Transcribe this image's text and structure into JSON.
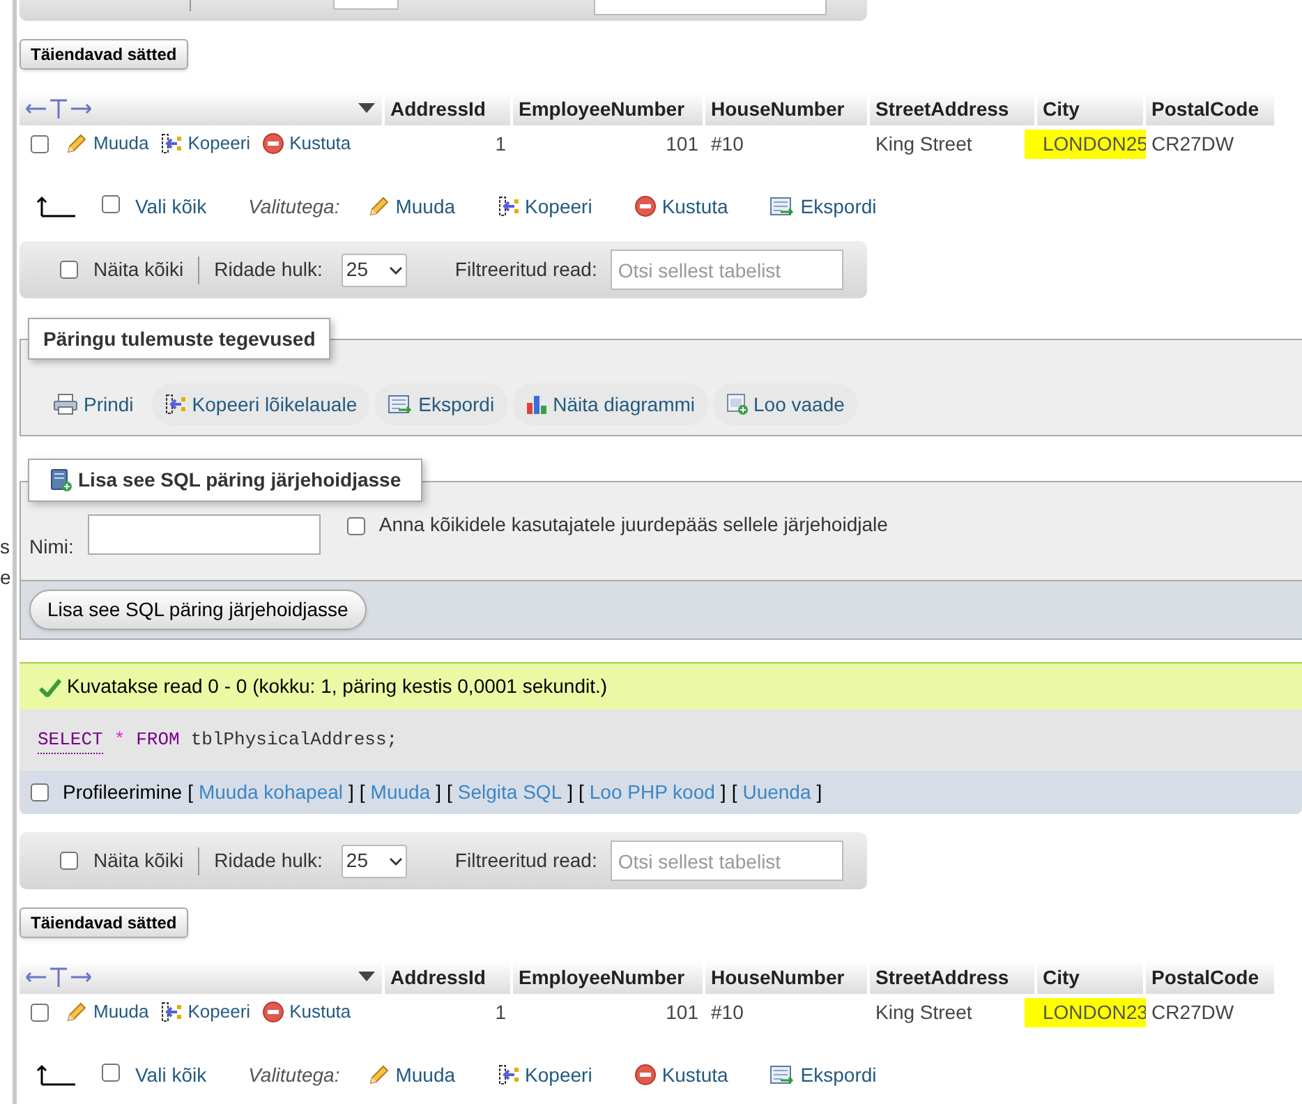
{
  "left_edge_fragments": [
    "s",
    "e"
  ],
  "upper_result": {
    "options_button": "Täiendavad sätted",
    "table": {
      "columns": [
        {
          "label": "AddressId",
          "kind": "number"
        },
        {
          "label": "EmployeeNumber",
          "kind": "number"
        },
        {
          "label": "HouseNumber",
          "kind": "text"
        },
        {
          "label": "StreetAddress",
          "kind": "text"
        },
        {
          "label": "City",
          "kind": "text"
        },
        {
          "label": "PostalCode",
          "kind": "text"
        }
      ],
      "rows": [
        {
          "selected": false,
          "actions": [
            {
              "label": "Muuda",
              "kind": "edit"
            },
            {
              "label": "Kopeeri",
              "kind": "copy"
            },
            {
              "label": "Kustuta",
              "kind": "delete"
            }
          ],
          "cells": [
            {
              "text": "1",
              "highlighted": false
            },
            {
              "text": "101",
              "highlighted": false
            },
            {
              "text": "#10",
              "highlighted": false
            },
            {
              "text": "King Street",
              "highlighted": false
            },
            {
              "text": "LONDON25",
              "highlighted": true
            },
            {
              "text": "CR27DW",
              "highlighted": false
            }
          ]
        }
      ]
    },
    "bulk_actions": {
      "select_all_label": "Vali kõik",
      "select_all_checked": false,
      "with_selected_label": "Valitutega:",
      "actions": [
        {
          "label": "Muuda",
          "kind": "edit"
        },
        {
          "label": "Kopeeri",
          "kind": "copy"
        },
        {
          "label": "Kustuta",
          "kind": "delete"
        },
        {
          "label": "Ekspordi",
          "kind": "export"
        }
      ]
    },
    "navigation": {
      "show_all_label": "Näita kõiki",
      "show_all_checked": false,
      "rows_label": "Ridade hulk:",
      "rows_value": "25",
      "filter_label": "Filtreeritud read:",
      "filter_placeholder": "Otsi sellest tabelist"
    }
  },
  "query_results_operations": {
    "legend": "Päringu tulemuste tegevused",
    "actions": [
      {
        "label": "Prindi",
        "kind": "print"
      },
      {
        "label": "Kopeeri lõikelauale",
        "kind": "copy"
      },
      {
        "label": "Ekspordi",
        "kind": "export"
      },
      {
        "label": "Näita diagrammi",
        "kind": "chart"
      },
      {
        "label": "Loo vaade",
        "kind": "view"
      }
    ]
  },
  "bookmark": {
    "legend": "Lisa see SQL päring järjehoidjasse",
    "name_label": "Nimi:",
    "share_label": "Anna kõikidele kasutajatele juurdepääs sellele järjehoidjale",
    "share_checked": false,
    "submit": "Lisa see SQL päring järjehoidjasse"
  },
  "message": {
    "text": "Kuvatakse read 0 - 0 (kokku: 1, päring kestis 0,0001 sekundit.)"
  },
  "sql": {
    "tokens": [
      {
        "text": "SELECT",
        "kind": "keyword"
      },
      {
        "text": "*",
        "kind": "operator"
      },
      {
        "text": "FROM",
        "kind": "keyword"
      },
      {
        "text": "tblPhysicalAddress;",
        "kind": "plain"
      }
    ]
  },
  "profiling": {
    "label": "Profileerimine",
    "checked": false,
    "parts": [
      {
        "text": "[",
        "kind": "bracket"
      },
      {
        "text": "Muuda kohapeal",
        "kind": "link"
      },
      {
        "text": "]",
        "kind": "bracket"
      },
      {
        "text": "[",
        "kind": "bracket"
      },
      {
        "text": "Muuda",
        "kind": "link"
      },
      {
        "text": "]",
        "kind": "bracket"
      },
      {
        "text": "[",
        "kind": "bracket"
      },
      {
        "text": "Selgita SQL",
        "kind": "link"
      },
      {
        "text": "]",
        "kind": "bracket"
      },
      {
        "text": "[",
        "kind": "bracket"
      },
      {
        "text": "Loo PHP kood",
        "kind": "link"
      },
      {
        "text": "]",
        "kind": "bracket"
      },
      {
        "text": "[",
        "kind": "bracket"
      },
      {
        "text": "Uuenda",
        "kind": "link"
      },
      {
        "text": "]",
        "kind": "bracket"
      }
    ]
  },
  "lower_result": {
    "navigation": {
      "show_all_label": "Näita kõiki",
      "show_all_checked": false,
      "rows_label": "Ridade hulk:",
      "rows_value": "25",
      "filter_label": "Filtreeritud read:",
      "filter_placeholder": "Otsi sellest tabelist"
    },
    "options_button": "Täiendavad sätted",
    "table": {
      "columns": [
        {
          "label": "AddressId",
          "kind": "number"
        },
        {
          "label": "EmployeeNumber",
          "kind": "number"
        },
        {
          "label": "HouseNumber",
          "kind": "text"
        },
        {
          "label": "StreetAddress",
          "kind": "text"
        },
        {
          "label": "City",
          "kind": "text"
        },
        {
          "label": "PostalCode",
          "kind": "text"
        }
      ],
      "rows": [
        {
          "selected": false,
          "actions": [
            {
              "label": "Muuda",
              "kind": "edit"
            },
            {
              "label": "Kopeeri",
              "kind": "copy"
            },
            {
              "label": "Kustuta",
              "kind": "delete"
            }
          ],
          "cells": [
            {
              "text": "1",
              "highlighted": false
            },
            {
              "text": "101",
              "highlighted": false
            },
            {
              "text": "#10",
              "highlighted": false
            },
            {
              "text": "King Street",
              "highlighted": false
            },
            {
              "text": "LONDON23",
              "highlighted": true
            },
            {
              "text": "CR27DW",
              "highlighted": false
            }
          ]
        }
      ]
    },
    "bulk_actions": {
      "select_all_label": "Vali kõik",
      "select_all_checked": false,
      "with_selected_label": "Valitutega:",
      "actions": [
        {
          "label": "Muuda",
          "kind": "edit"
        },
        {
          "label": "Kopeeri",
          "kind": "copy"
        },
        {
          "label": "Kustuta",
          "kind": "delete"
        },
        {
          "label": "Ekspordi",
          "kind": "export"
        }
      ]
    }
  }
}
